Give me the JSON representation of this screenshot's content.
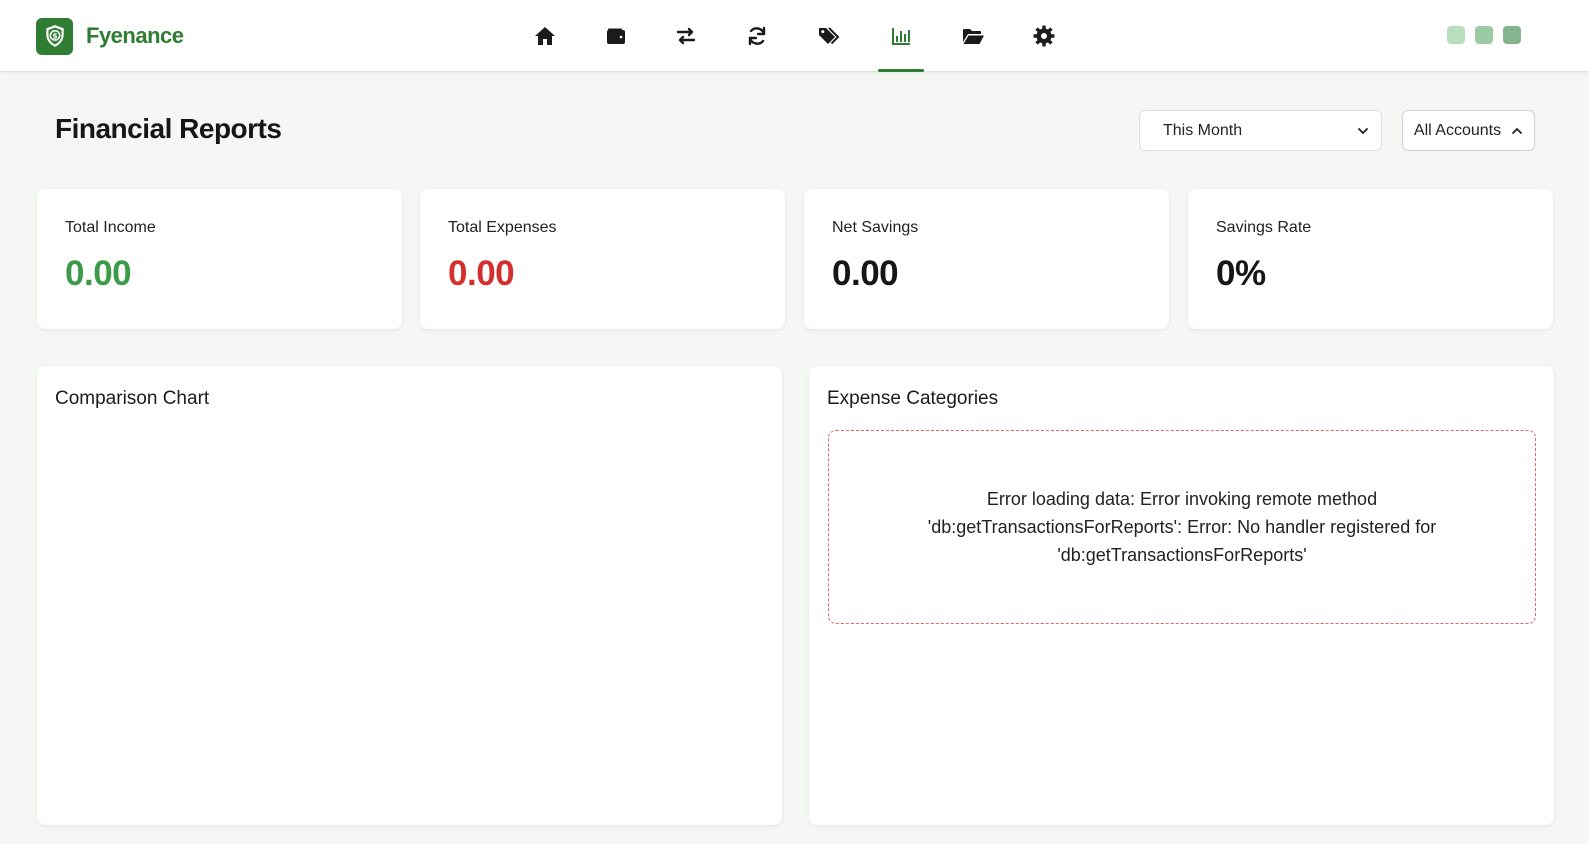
{
  "app": {
    "name": "Fyenance",
    "brand_color": "#2e7d32",
    "logo_icon": "shield-dollar-icon"
  },
  "nav": {
    "items": [
      {
        "icon": "home-icon"
      },
      {
        "icon": "wallet-icon"
      },
      {
        "icon": "transfer-arrows-icon"
      },
      {
        "icon": "sync-icon"
      },
      {
        "icon": "tags-icon"
      },
      {
        "icon": "bar-chart-icon",
        "active": true
      },
      {
        "icon": "folder-open-icon"
      },
      {
        "icon": "gear-icon"
      }
    ]
  },
  "window_controls": {
    "colors": [
      "#b7dfbb",
      "#9ccaa2",
      "#86b48d"
    ]
  },
  "page": {
    "title": "Financial Reports",
    "period_select": {
      "value": "This Month"
    },
    "accounts_button": {
      "label": "All Accounts"
    }
  },
  "stats": [
    {
      "label": "Total Income",
      "value": "0.00",
      "color": "#3d9a48"
    },
    {
      "label": "Total Expenses",
      "value": "0.00",
      "color": "#d32f2f"
    },
    {
      "label": "Net Savings",
      "value": "0.00",
      "color": "#161616"
    },
    {
      "label": "Savings Rate",
      "value": "0%",
      "color": "#161616"
    }
  ],
  "panels": {
    "comparison": {
      "title": "Comparison Chart"
    },
    "expense_categories": {
      "title": "Expense Categories",
      "error": "Error loading data: Error invoking remote method 'db:getTransactionsForReports': Error: No handler registered for 'db:getTransactionsForReports'"
    }
  }
}
